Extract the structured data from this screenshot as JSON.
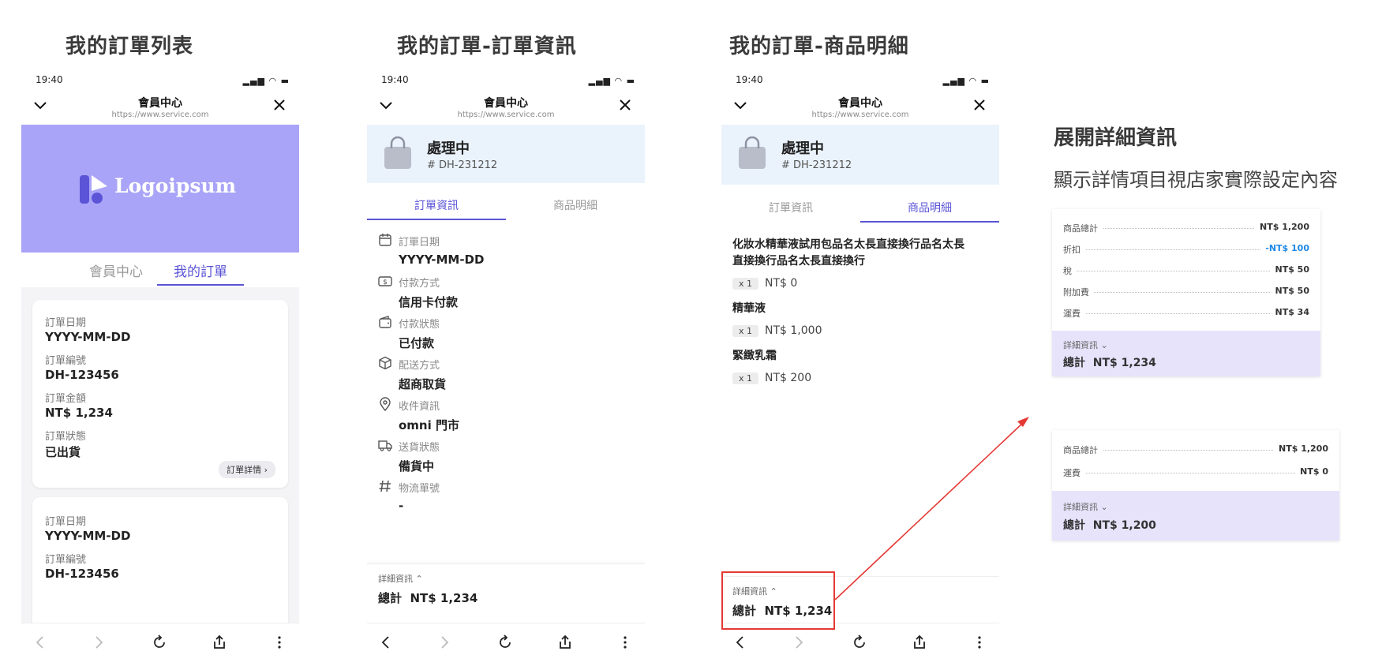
{
  "sections": {
    "list_title": "我的訂單列表",
    "info_title": "我的訂單-訂單資訊",
    "items_title": "我的訂單-商品明細",
    "expand_title": "展開詳細資訊",
    "expand_subtitle": "顯示詳情項目視店家實際設定內容"
  },
  "phone_common": {
    "time": "19:40",
    "signal": "▂▄▆ ◠ ▬",
    "nav_title": "會員中心",
    "nav_url": "https://www.service.com"
  },
  "screen1": {
    "logo_text": "Logoipsum",
    "tabs": [
      "會員中心",
      "我的訂單"
    ],
    "orders": [
      {
        "date_label": "訂單日期",
        "date_value": "YYYY-MM-DD",
        "no_label": "訂單編號",
        "no_value": "DH-123456",
        "amount_label": "訂單金額",
        "amount_value": "NT$ 1,234",
        "status_label": "訂單狀態",
        "status_value": "已出貨",
        "detail_button": "訂單詳情 ›"
      },
      {
        "date_label": "訂單日期",
        "date_value": "YYYY-MM-DD",
        "no_label": "訂單編號",
        "no_value": "DH-123456"
      }
    ]
  },
  "screen2": {
    "status": "處理中",
    "order_no": "# DH-231212",
    "tabs": [
      "訂單資訊",
      "商品明細"
    ],
    "rows": [
      {
        "label": "訂單日期",
        "value": "YYYY-MM-DD",
        "icon": "calendar-icon"
      },
      {
        "label": "付款方式",
        "value": "信用卡付款",
        "icon": "cash-icon"
      },
      {
        "label": "付款狀態",
        "value": "已付款",
        "icon": "wallet-icon"
      },
      {
        "label": "配送方式",
        "value": "超商取貨",
        "icon": "package-icon"
      },
      {
        "label": "收件資訊",
        "value": "omni 門市",
        "icon": "location-pin-icon"
      },
      {
        "label": "送貨狀態",
        "value": "備貨中",
        "icon": "truck-icon"
      },
      {
        "label": "物流單號",
        "value": "-",
        "icon": "hash-icon"
      }
    ],
    "footer_label": "詳細資訊 ⌃",
    "footer_total": "總計  NT$ 1,234"
  },
  "screen3": {
    "status": "處理中",
    "order_no": "# DH-231212",
    "tabs": [
      "訂單資訊",
      "商品明細"
    ],
    "items": [
      {
        "name_line1": "化妝水精華液試用包品名太長直接換行品名太長",
        "name_line2": "直接換行品名太長直接換行",
        "qty": "x 1",
        "price": "NT$ 0"
      },
      {
        "name_line1": "精華液",
        "qty": "x 1",
        "price": "NT$ 1,000"
      },
      {
        "name_line1": "緊緻乳霜",
        "qty": "x 1",
        "price": "NT$ 200"
      }
    ],
    "footer_label": "詳細資訊 ⌃",
    "footer_total": "總計  NT$ 1,234"
  },
  "panel1": {
    "rows": [
      {
        "label": "商品總計",
        "value": "NT$ 1,200"
      },
      {
        "label": "折扣",
        "value": "-NT$ 100"
      },
      {
        "label": "稅",
        "value": "NT$ 50"
      },
      {
        "label": "附加費",
        "value": "NT$ 50"
      },
      {
        "label": "運費",
        "value": "NT$ 34"
      }
    ],
    "footer_label": "詳細資訊 ⌄",
    "footer_total": "總計  NT$ 1,234"
  },
  "panel2": {
    "rows": [
      {
        "label": "商品總計",
        "value": "NT$ 1,200"
      },
      {
        "label": "運費",
        "value": "NT$ 0"
      }
    ],
    "footer_label": "詳細資訊 ⌄",
    "footer_total": "總計  NT$ 1,200"
  },
  "colors": {
    "accent": "#5b54d6",
    "logo_bg": "#a9a4f7",
    "status_bg": "#eaf3fc",
    "summary_bg": "#e6e3fb",
    "discount": "#1e88e5",
    "arrow": "#e53935"
  }
}
